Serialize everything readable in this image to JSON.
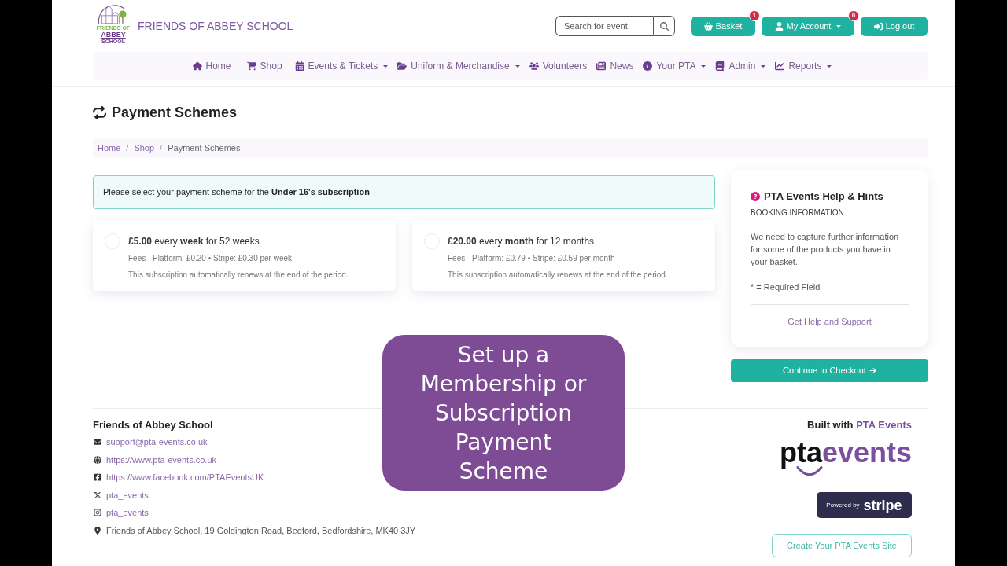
{
  "header": {
    "logo": {
      "lines": [
        "FRIENDS OF",
        "ABBEY",
        "SCHOOL"
      ]
    },
    "site_title": "FRIENDS OF ABBEY SCHOOL",
    "search": {
      "placeholder": "Search for event"
    },
    "buttons": [
      {
        "kind": "basket",
        "label": "Basket",
        "badge": "1",
        "dropdown": false
      },
      {
        "kind": "account",
        "label": "My Account",
        "badge": "0",
        "dropdown": true
      },
      {
        "kind": "logout",
        "label": "Log out",
        "dropdown": false
      }
    ]
  },
  "nav": [
    {
      "kind": "home",
      "label": "Home",
      "dropdown": false
    },
    {
      "kind": "cart",
      "label": "Shop",
      "dropdown": false
    },
    {
      "kind": "calendar",
      "label": "Events & Tickets",
      "dropdown": true
    },
    {
      "kind": "folder",
      "label": "Uniform & Merchandise",
      "dropdown": true
    },
    {
      "kind": "users",
      "label": "Volunteers",
      "dropdown": false
    },
    {
      "kind": "news",
      "label": "News",
      "dropdown": false
    },
    {
      "kind": "info",
      "label": "Your PTA",
      "dropdown": true
    },
    {
      "kind": "book",
      "label": "Admin",
      "dropdown": true
    },
    {
      "kind": "chart",
      "label": "Reports",
      "dropdown": true
    }
  ],
  "page_title": "Payment Schemes",
  "breadcrumb": [
    {
      "kind": "link",
      "label": "Home"
    },
    {
      "kind": "separator",
      "label": "/"
    },
    {
      "kind": "link",
      "label": "Shop"
    },
    {
      "kind": "separator",
      "label": "/"
    },
    {
      "kind": "current",
      "label": "Payment Schemes"
    }
  ],
  "alert": "Please select your payment scheme for the **Under 16's subscription**",
  "schemes": [
    {
      "title": "**£5.00** every **week** for 52 weeks",
      "fees": "Fees - Platform: £0.20 • Stripe: £0.30 per week",
      "note": "This subscription automatically renews at the end of the period.",
      "selected": false
    },
    {
      "title": "**£20.00** every **month** for 12 months",
      "fees": "Fees - Platform: £0.79 • Stripe: £0.59 per month",
      "note": "This subscription automatically renews at the end of the period.",
      "selected": false
    }
  ],
  "help": {
    "title": "PTA Events Help & Hints",
    "subtitle": "BOOKING INFORMATION",
    "text": "We need to capture further information for some of the products you have in your basket.",
    "required_note": "* = Required Field",
    "link": "Get Help and Support"
  },
  "checkout_button": "Continue to Checkout",
  "footer": {
    "name": "Friends of Abbey School",
    "contacts": [
      {
        "kind": "email",
        "text": "support@pta-events.co.uk"
      },
      {
        "kind": "website",
        "text": "https://www.pta-events.co.uk"
      },
      {
        "kind": "facebook",
        "text": "https://www.facebook.com/PTAEventsUK"
      },
      {
        "kind": "x",
        "text": "pta_events"
      },
      {
        "kind": "instagram",
        "text": "pta_events"
      },
      {
        "kind": "address",
        "text": "Friends of Abbey School, 19 Goldington Road, Bedford, Bedfordshire, MK40 3JY"
      }
    ],
    "built_with": {
      "label": "Built with",
      "link": "PTA Events"
    },
    "brand_logo": {
      "dark_part": "pta",
      "colored_part": "events"
    },
    "stripe_badge": {
      "prefix": "Powered by",
      "brand": "stripe"
    },
    "create_button": "Create Your PTA Events Site"
  },
  "caption": "Set up a Membership or Subscription Payment Scheme"
}
